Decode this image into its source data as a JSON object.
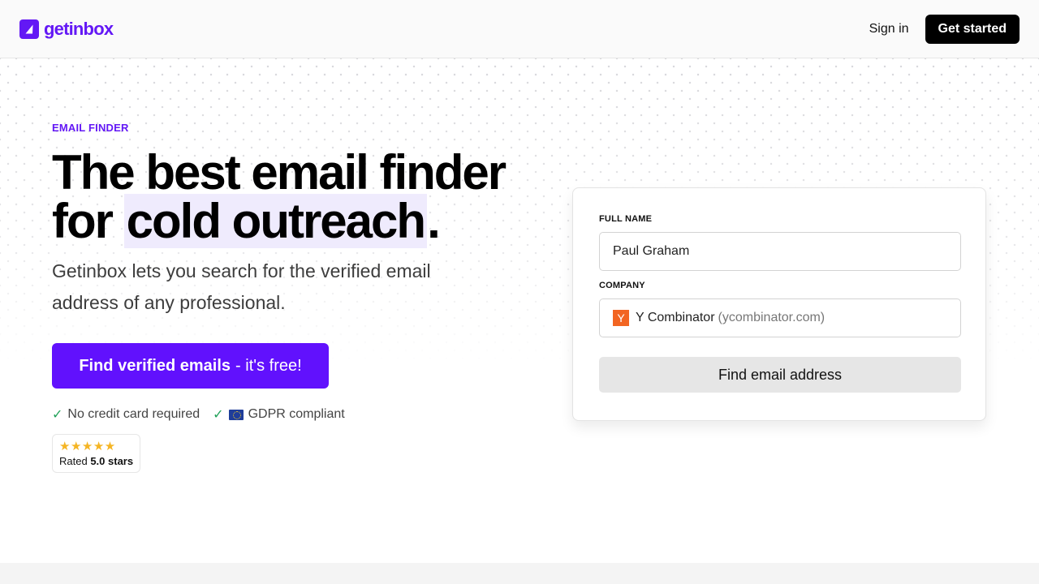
{
  "header": {
    "brand": "getinbox",
    "brand_color": "#6318f5",
    "nav": {
      "sign_in": "Sign in",
      "get_started": "Get started"
    }
  },
  "hero": {
    "eyebrow": "EMAIL FINDER",
    "headline_line1": "The best email finder",
    "headline_line2_prefix": "for ",
    "headline_highlight": "cold outreach",
    "headline_suffix": ".",
    "subtext": "Getinbox lets you search for the verified email address of any professional.",
    "cta_bold": "Find verified emails",
    "cta_light": "- it's free!",
    "cta_color": "#6111fd",
    "badges": [
      {
        "icon": "check-icon",
        "label": "No credit card required"
      },
      {
        "icon": "eu-flag-icon",
        "label": "GDPR compliant"
      }
    ],
    "rating": {
      "stars": "★★★★★",
      "prefix": "Rated",
      "value": "5.0 stars",
      "score": 5.0,
      "max": 5
    }
  },
  "form": {
    "full_name_label": "FULL NAME",
    "full_name_value": "Paul Graham",
    "company_label": "COMPANY",
    "company_logo_letter": "Y",
    "company_name": "Y Combinator",
    "company_domain": "(ycombinator.com)",
    "submit_label": "Find email address"
  }
}
